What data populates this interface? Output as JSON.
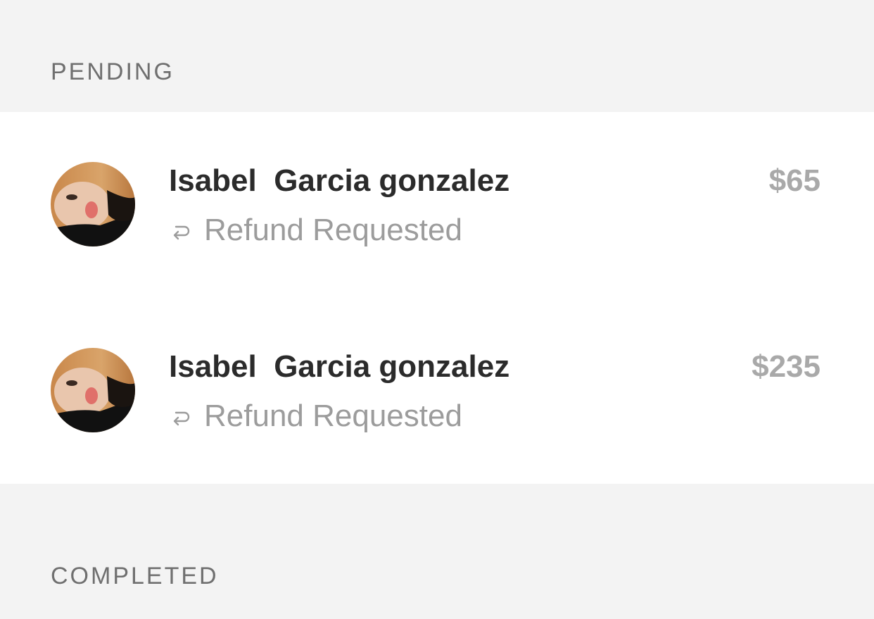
{
  "sections": {
    "pending_label": "PENDING",
    "completed_label": "COMPLETED"
  },
  "pending": [
    {
      "name": "Isabel  Garcia gonzalez",
      "status": "Refund Requested",
      "status_icon": "refund-return-icon",
      "amount": "$65"
    },
    {
      "name": "Isabel  Garcia gonzalez",
      "status": "Refund Requested",
      "status_icon": "refund-return-icon",
      "amount": "$235"
    }
  ],
  "colors": {
    "background": "#f3f3f3",
    "card": "#ffffff",
    "name_text": "#2b2b2b",
    "secondary_text": "#9c9c9c",
    "amount_text": "#a9a9a9",
    "header_text": "#6f6f6f"
  }
}
